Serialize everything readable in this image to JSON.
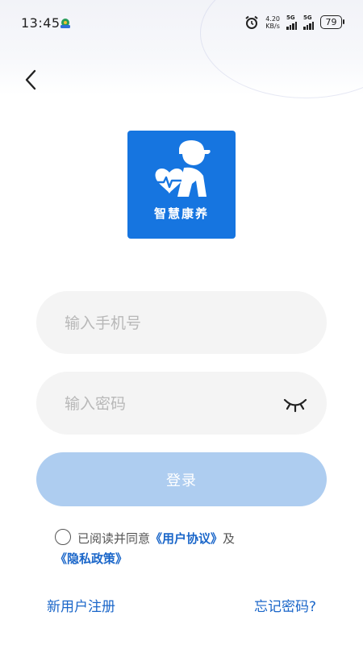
{
  "status_bar": {
    "time": "13:45",
    "net_speed_value": "4.20",
    "net_speed_unit": "KB/s",
    "sim1_label": "5G",
    "sim2_label": "5G",
    "battery": "79"
  },
  "logo": {
    "text": "智慧康养",
    "bg_color": "#1675e0"
  },
  "form": {
    "phone_placeholder": "输入手机号",
    "phone_value": "",
    "password_placeholder": "输入密码",
    "password_value": "",
    "login_label": "登录"
  },
  "agreement": {
    "prefix": "已阅读并同意",
    "user_agreement": "《用户协议》",
    "and": "及",
    "privacy_policy": "《隐私政策》",
    "checked": false
  },
  "links": {
    "register": "新用户注册",
    "forgot_password": "忘记密码?"
  },
  "colors": {
    "accent": "#1a66c9",
    "login_button_disabled": "#aecdf0",
    "field_bg": "#f4f4f4"
  }
}
